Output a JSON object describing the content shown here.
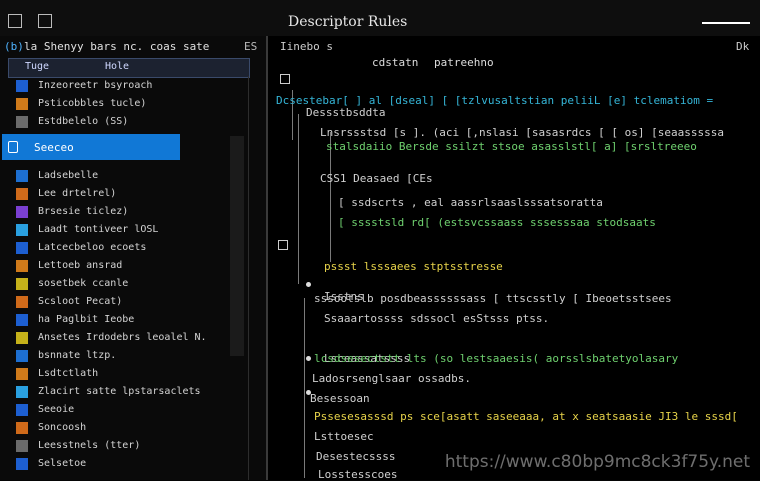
{
  "window": {
    "title": "Descriptor Rules"
  },
  "colors": {
    "accent": "#1178d6",
    "background": "#000000",
    "green": "#6fd16f",
    "cyan": "#35b6d8",
    "yellow": "#e7d34a"
  },
  "sidebar": {
    "header": [
      "(b)",
      "la Shenyy bars nc. coas sate",
      "ES"
    ],
    "tabs": [
      "Tuge",
      "Hole"
    ],
    "items": [
      {
        "label": "Inzeoreetr bsyroach",
        "icon": "blue-square-icon",
        "color": "#1d5fd1"
      },
      {
        "label": "Psticobbles tucle)",
        "icon": "orange-square-icon",
        "color": "#cf7a1a"
      },
      {
        "label": "Estdbelelo (SS)",
        "icon": "gray-square-icon",
        "color": "#6b6b6b"
      },
      {
        "label": "Seeceo",
        "icon": "lock-icon",
        "color": "#ffffff",
        "selected": true
      },
      {
        "label": "Ladsebelle",
        "icon": "blue-square-icon",
        "color": "#1d6fd1"
      },
      {
        "label": "Lee drtelrel)",
        "icon": "orange-square-icon",
        "color": "#cf6a1a"
      },
      {
        "label": "Brsesie ticlez)",
        "icon": "purple-square-icon",
        "color": "#7a3fd1"
      },
      {
        "label": "Laadt tontiveer lOSL",
        "icon": "cyan-square-icon",
        "color": "#2aa0e0"
      },
      {
        "label": "Latcecbeloo ecoets",
        "icon": "blue-square-icon",
        "color": "#1d5fd1"
      },
      {
        "label": "Lettoeb ansrad",
        "icon": "orange-square-icon",
        "color": "#cf7a1a"
      },
      {
        "label": "sosetbek ccanle",
        "icon": "yellow-square-icon",
        "color": "#c6b21a"
      },
      {
        "label": "Scsloot Pecat)",
        "icon": "orange-square-icon",
        "color": "#cf6a1a"
      },
      {
        "label": "ha Paglbit Ieobe",
        "icon": "blue-square-icon",
        "color": "#1d5fd1"
      },
      {
        "label": "Ansetes Irdodebrs leoalel N.",
        "icon": "yellow-square-icon",
        "color": "#c6b21a"
      },
      {
        "label": "bsnnate ltzp.",
        "icon": "blue-square-icon",
        "color": "#1d6fd1"
      },
      {
        "label": "Lsdtctlath",
        "icon": "orange-square-icon",
        "color": "#cf7a1a"
      },
      {
        "label": "Zlacirt satte lpstarsaclets",
        "icon": "cyan-square-icon",
        "color": "#2aa0e0"
      },
      {
        "label": "Seeoie",
        "icon": "blue-square-icon",
        "color": "#1d5fd1"
      },
      {
        "label": "Soncoosh",
        "icon": "orange-square-icon",
        "color": "#cf6a1a"
      },
      {
        "label": "Leesstnels (tter)",
        "icon": "gray-square-icon",
        "color": "#6b6b6b"
      },
      {
        "label": "Selsetoe",
        "icon": "blue-square-icon",
        "color": "#1d5fd1"
      }
    ]
  },
  "editor": {
    "header_left": "Iinebo s",
    "header_mid": "cdstatn",
    "header_mid2": "patreehno",
    "header_right": "Dk",
    "lines": [
      {
        "text": "Dessstbsddta",
        "color": "#d0d0d0"
      },
      {
        "text": "Dcsestebar[ ] al [dseal] [ [tzlvusaltstian peliiL [e] tclematiom =",
        "color": "#35b6d8"
      },
      {
        "text": "Lnsrssstsd [s ]. (aci [,nslasi [sasasrdcs [ [ os] [seaasssssa",
        "color": "#d0d0d0"
      },
      {
        "text": "stalsdaiio Bersde ssilzt stsoe asasslstl[ a] [srsltreeeo",
        "color": "#6fd16f"
      },
      {
        "text": "CSS1 Deasaed [CEs",
        "color": "#d0d0d0"
      },
      {
        "text": "[ ssdscrts ,  eal  aassrlsaaslsssatsoratta",
        "color": "#d0d0d0"
      },
      {
        "text": "[ sssstsld rd[ (estsvcssaass sssesssaa stodsaats",
        "color": "#6fd16f"
      },
      {
        "text": "pssst lsssaees stptsstresse",
        "color": "#e7d34a"
      },
      {
        "text": "Isstns",
        "color": "#d0d0d0"
      },
      {
        "text": "sssootslb posdbeassssssass [  ttscsstly [ Ibeoetsstsees",
        "color": "#d0d0d0"
      },
      {
        "text": "Ssaaartossss sdssocl esStsss ptss.",
        "color": "#d0d0d0"
      },
      {
        "text": "Lsceassatssss",
        "color": "#d0d0d0"
      },
      {
        "text": "lcsdsesectstt lts (so lestsaaesis( aorsslsbatetyolasary",
        "color": "#6fd16f"
      },
      {
        "text": "Ladosrsenglsaar  ossadbs.",
        "color": "#d0d0d0"
      },
      {
        "text": "Besessoan",
        "color": "#d0d0d0"
      },
      {
        "text": "Pssesesasssd ps  sce[asatt saseeaaa,  at x  seatsaasie  JI3  le sssd[",
        "color": "#e7d34a"
      },
      {
        "text": "Lsttoesec",
        "color": "#d0d0d0"
      },
      {
        "text": "Desestecssss",
        "color": "#d0d0d0"
      },
      {
        "text": "Losstesscoes",
        "color": "#d0d0d0"
      }
    ]
  },
  "watermark": "https://www.c80bp9mc8ck3f75y.net"
}
